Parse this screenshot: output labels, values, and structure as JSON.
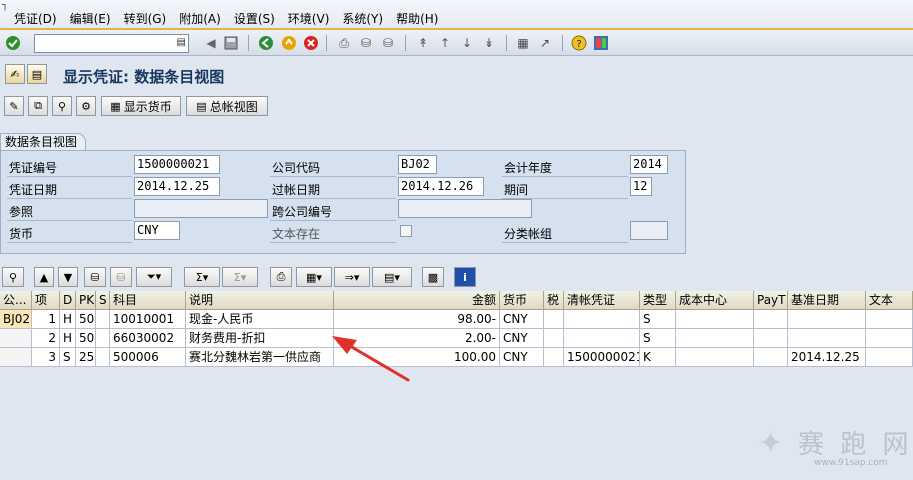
{
  "menu": {
    "items": [
      "凭证(D)",
      "编辑(E)",
      "转到(G)",
      "附加(A)",
      "设置(S)",
      "环境(V)",
      "系统(Y)",
      "帮助(H)"
    ]
  },
  "toolbar": {
    "command_value": "",
    "icons": [
      "enter-icon",
      "back-icon",
      "exit-icon",
      "cancel-icon",
      "print-icon",
      "find-icon",
      "find-next-icon",
      "first-page-icon",
      "prev-page-icon",
      "next-page-icon",
      "last-page-icon",
      "new-session-icon",
      "shortcut-icon",
      "help-icon",
      "layout-icon"
    ]
  },
  "title": {
    "text": "显示凭证: 数据条目视图"
  },
  "app_toolbar": {
    "show_currency_label": "显示货币",
    "general_ledger_label": "总帐视图"
  },
  "header": {
    "panel_title": "数据条目视图",
    "fields": {
      "doc_number_label": "凭证编号",
      "doc_number": "1500000021",
      "company_code_label": "公司代码",
      "company_code": "BJ02",
      "fiscal_year_label": "会计年度",
      "fiscal_year": "2014",
      "doc_date_label": "凭证日期",
      "doc_date": "2014.12.25",
      "posting_date_label": "过帐日期",
      "posting_date": "2014.12.26",
      "period_label": "期间",
      "period": "12",
      "reference_label": "参照",
      "reference": "",
      "cross_company_label": "跨公司编号",
      "cross_company": "",
      "currency_label": "货币",
      "currency": "CNY",
      "text_exists_label": "文本存在",
      "ledger_group_label": "分类帐组",
      "ledger_group": ""
    }
  },
  "grid": {
    "columns": [
      "公...",
      "项",
      "D",
      "PK",
      "S",
      "科目",
      "说明",
      "金额",
      "货币",
      "税",
      "清帐凭证",
      "类型",
      "成本中心",
      "PayT",
      "基准日期",
      "文本"
    ],
    "rows": [
      {
        "company": "BJ02",
        "item": "1",
        "dc": "H",
        "pk": "50",
        "s": "",
        "account": "10010001",
        "desc": "现金-人民币",
        "amount": "98.00-",
        "currency": "CNY",
        "tax": "",
        "clearing": "",
        "type": "S",
        "cost_center": "",
        "payt": "",
        "baseline": "",
        "text": ""
      },
      {
        "company": "",
        "item": "2",
        "dc": "H",
        "pk": "50",
        "s": "",
        "account": "66030002",
        "desc": "财务费用-折扣",
        "amount": "2.00-",
        "currency": "CNY",
        "tax": "",
        "clearing": "",
        "type": "S",
        "cost_center": "",
        "payt": "",
        "baseline": "",
        "text": ""
      },
      {
        "company": "",
        "item": "3",
        "dc": "S",
        "pk": "25",
        "s": "",
        "account": "500006",
        "desc": "赛北分魏林岩第一供应商",
        "amount": "100.00",
        "currency": "CNY",
        "tax": "",
        "clearing": "1500000021",
        "type": "K",
        "cost_center": "",
        "payt": "",
        "baseline": "2014.12.25",
        "text": ""
      }
    ]
  },
  "watermark": {
    "text": "赛 跑 网",
    "url": "www.91sap.com"
  },
  "colors": {
    "menu_accent": "#e6b24a",
    "arrow": "#e0302b",
    "title": "#16365e",
    "key_cell": "#f9e7b7"
  }
}
